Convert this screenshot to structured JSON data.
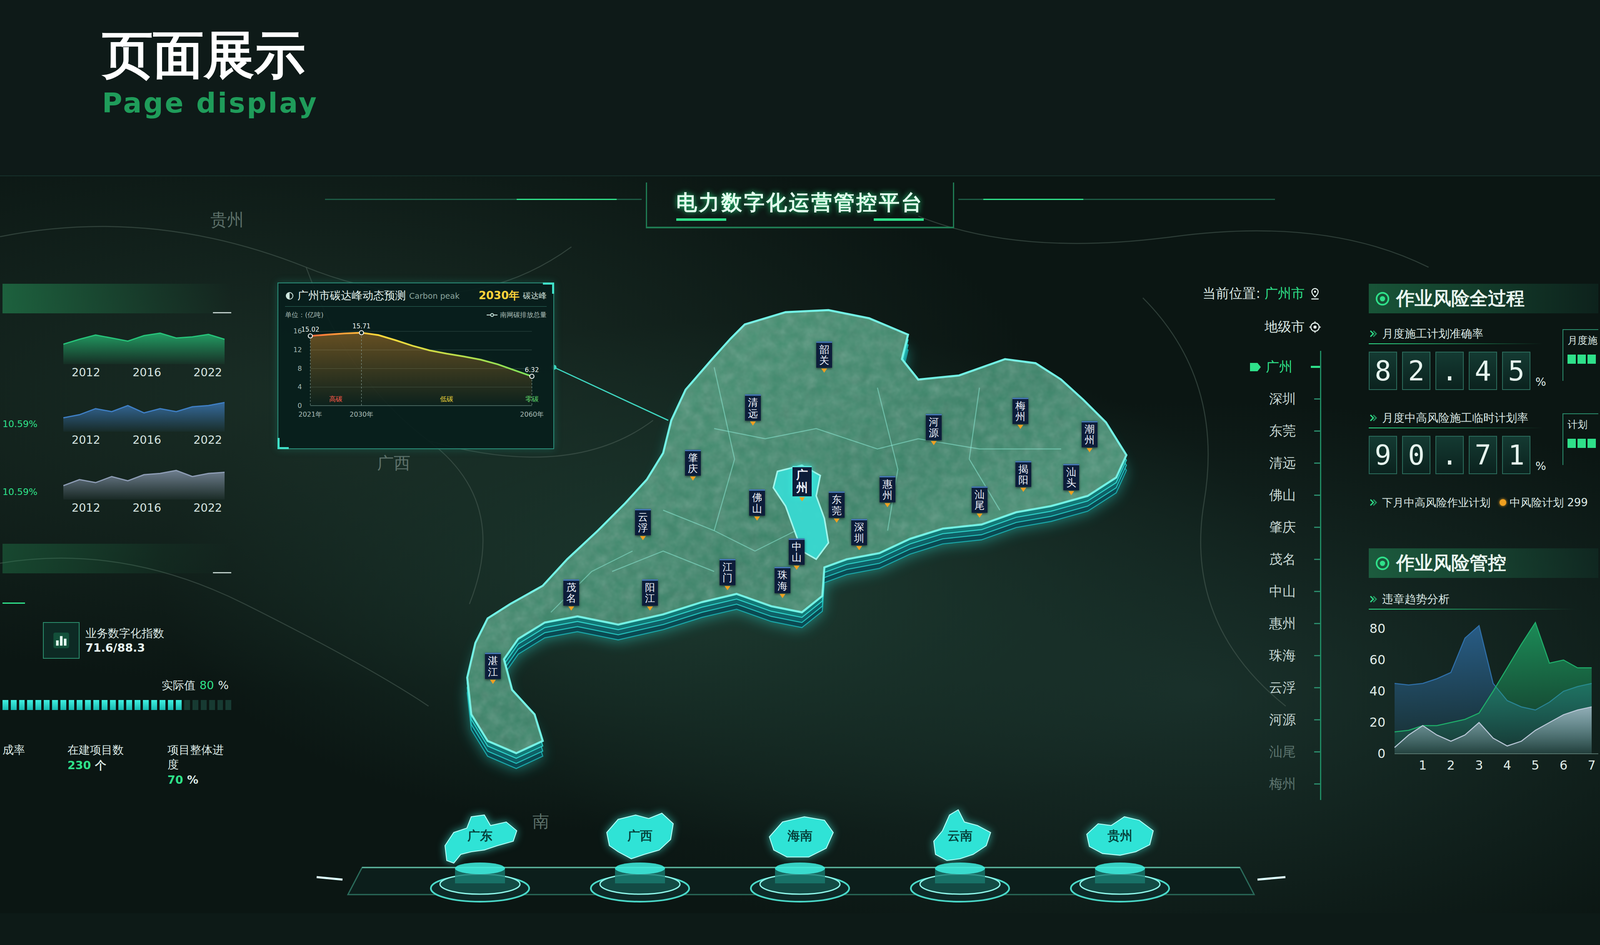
{
  "page": {
    "title": "页面展示",
    "subtitle": "Page display"
  },
  "dashboard": {
    "title": "电力数字化运营管控平台",
    "background_labels": [
      "贵州",
      "广西",
      "南"
    ]
  },
  "left_panel": {
    "trend_charts": [
      {
        "color": "#27c47a",
        "values": [
          30,
          38,
          45,
          40,
          35,
          44,
          48,
          40,
          42,
          46,
          38
        ],
        "ticks": [
          "2012",
          "2016",
          "2022"
        ]
      },
      {
        "percent": "10.59%",
        "color": "#3f7fc4",
        "values": [
          20,
          25,
          35,
          30,
          40,
          28,
          35,
          30,
          38,
          40,
          45
        ],
        "ticks": [
          "2012",
          "2016",
          "2022"
        ]
      },
      {
        "percent": "10.59%",
        "color": "#8d9cb4",
        "values": [
          20,
          30,
          25,
          35,
          28,
          38,
          40,
          45,
          35,
          40,
          42
        ],
        "ticks": [
          "2012",
          "2016",
          "2022"
        ]
      }
    ],
    "index_card": {
      "label": "业务数字化指数",
      "value": "71.6/88.3"
    },
    "progress": {
      "label": "实际值",
      "value": "80",
      "unit": "%",
      "level": 0.8
    },
    "stats": [
      {
        "label": "成率"
      },
      {
        "label": "在建项目数",
        "value": "230",
        "unit": "个"
      },
      {
        "label": "项目整体进度",
        "value": "70",
        "unit": "%"
      }
    ]
  },
  "carbon_popup": {
    "title": "广州市碳达峰动态预测",
    "subtitle": "Carbon peak",
    "peak_year": "2030年",
    "peak_label": "碳达峰",
    "unit": "单位：(亿吨)",
    "legend": "南网碳排放总量",
    "y_ticks": [
      "16",
      "12",
      "8",
      "4",
      "0"
    ],
    "x_ticks": [
      {
        "label": "2021年",
        "index": 0
      },
      {
        "label": "2030年",
        "index": 3
      },
      {
        "label": "2060年",
        "index": 13
      }
    ],
    "values": [
      15.02,
      15.3,
      15.55,
      15.71,
      15.2,
      14.1,
      12.9,
      11.9,
      11.2,
      10.6,
      9.9,
      8.9,
      7.6,
      6.32
    ],
    "markers": [
      {
        "index": 0,
        "label": "15.02"
      },
      {
        "index": 3,
        "label": "15.71"
      },
      {
        "index": 13,
        "label": "6.32"
      }
    ],
    "zones": [
      {
        "label": "高碳",
        "color": "#ff5a4a"
      },
      {
        "label": "低碳",
        "color": "#e8d23a"
      },
      {
        "label": "零碳",
        "color": "#5fd86a"
      }
    ]
  },
  "map": {
    "cities": [
      {
        "name": "韶关",
        "selected": false
      },
      {
        "name": "清远",
        "selected": false
      },
      {
        "name": "肇庆",
        "selected": false
      },
      {
        "name": "广州",
        "selected": true
      },
      {
        "name": "佛山",
        "selected": false
      },
      {
        "name": "东莞",
        "selected": false
      },
      {
        "name": "惠州",
        "selected": false
      },
      {
        "name": "河源",
        "selected": false
      },
      {
        "name": "梅州",
        "selected": false
      },
      {
        "name": "潮州",
        "selected": false
      },
      {
        "name": "揭阳",
        "selected": false
      },
      {
        "name": "汕头",
        "selected": false
      },
      {
        "name": "汕尾",
        "selected": false
      },
      {
        "name": "深圳",
        "selected": false
      },
      {
        "name": "中山",
        "selected": false
      },
      {
        "name": "珠海",
        "selected": false
      },
      {
        "name": "江门",
        "selected": false
      },
      {
        "name": "云浮",
        "selected": false
      },
      {
        "name": "阳江",
        "selected": false
      },
      {
        "name": "茂名",
        "selected": false
      },
      {
        "name": "湛江",
        "selected": false
      }
    ]
  },
  "city_list": {
    "location_label": "当前位置:",
    "location_value": "广州市",
    "level_label": "地级市",
    "items": [
      {
        "name": "广州",
        "selected": true,
        "dimmed": false
      },
      {
        "name": "深圳",
        "selected": false,
        "dimmed": false
      },
      {
        "name": "东莞",
        "selected": false,
        "dimmed": false
      },
      {
        "name": "清远",
        "selected": false,
        "dimmed": false
      },
      {
        "name": "佛山",
        "selected": false,
        "dimmed": false
      },
      {
        "name": "肇庆",
        "selected": false,
        "dimmed": false
      },
      {
        "name": "茂名",
        "selected": false,
        "dimmed": false
      },
      {
        "name": "中山",
        "selected": false,
        "dimmed": false
      },
      {
        "name": "惠州",
        "selected": false,
        "dimmed": false
      },
      {
        "name": "珠海",
        "selected": false,
        "dimmed": false
      },
      {
        "name": "云浮",
        "selected": false,
        "dimmed": false
      },
      {
        "name": "河源",
        "selected": false,
        "dimmed": false
      },
      {
        "name": "汕尾",
        "selected": false,
        "dimmed": true
      },
      {
        "name": "梅州",
        "selected": false,
        "dimmed": true
      }
    ]
  },
  "right_panel": {
    "process_header": "作业风险全过程",
    "metrics": [
      {
        "label": "月度施工计划准确率",
        "digits": [
          "8",
          "2",
          ".",
          "4",
          "5"
        ],
        "unit": "%",
        "side_label": "月度施"
      },
      {
        "label": "月度中高风险施工临时计划率",
        "digits": [
          "9",
          "0",
          ".",
          "7",
          "1"
        ],
        "unit": "%",
        "side_label": "计划"
      }
    ],
    "plan": {
      "label": "下月中高风险作业计划",
      "legend": "中风险计划 299",
      "legend_color": "#f0a020"
    },
    "control_header": "作业风险管控",
    "violation_chart": {
      "title": "违章趋势分析",
      "y_ticks": [
        "80",
        "60",
        "40",
        "20",
        "0"
      ],
      "x_ticks": [
        "1",
        "2",
        "3",
        "4",
        "5",
        "6",
        "7"
      ],
      "series": [
        {
          "color": "#2f6fa8",
          "values": [
            45,
            44,
            45,
            48,
            52,
            74,
            82,
            45,
            34,
            30,
            28,
            33,
            40,
            43,
            45
          ]
        },
        {
          "color": "#1fae6a",
          "values": [
            14,
            15,
            18,
            18,
            20,
            22,
            26,
            40,
            55,
            70,
            84,
            58,
            60,
            55,
            55
          ]
        },
        {
          "color": "#b8c6d6",
          "values": [
            4,
            12,
            18,
            12,
            8,
            12,
            20,
            10,
            5,
            8,
            15,
            20,
            25,
            28,
            30
          ]
        }
      ]
    }
  },
  "provinces": [
    {
      "name": "广东"
    },
    {
      "name": "广西"
    },
    {
      "name": "海南"
    },
    {
      "name": "云南"
    },
    {
      "name": "贵州"
    }
  ]
}
